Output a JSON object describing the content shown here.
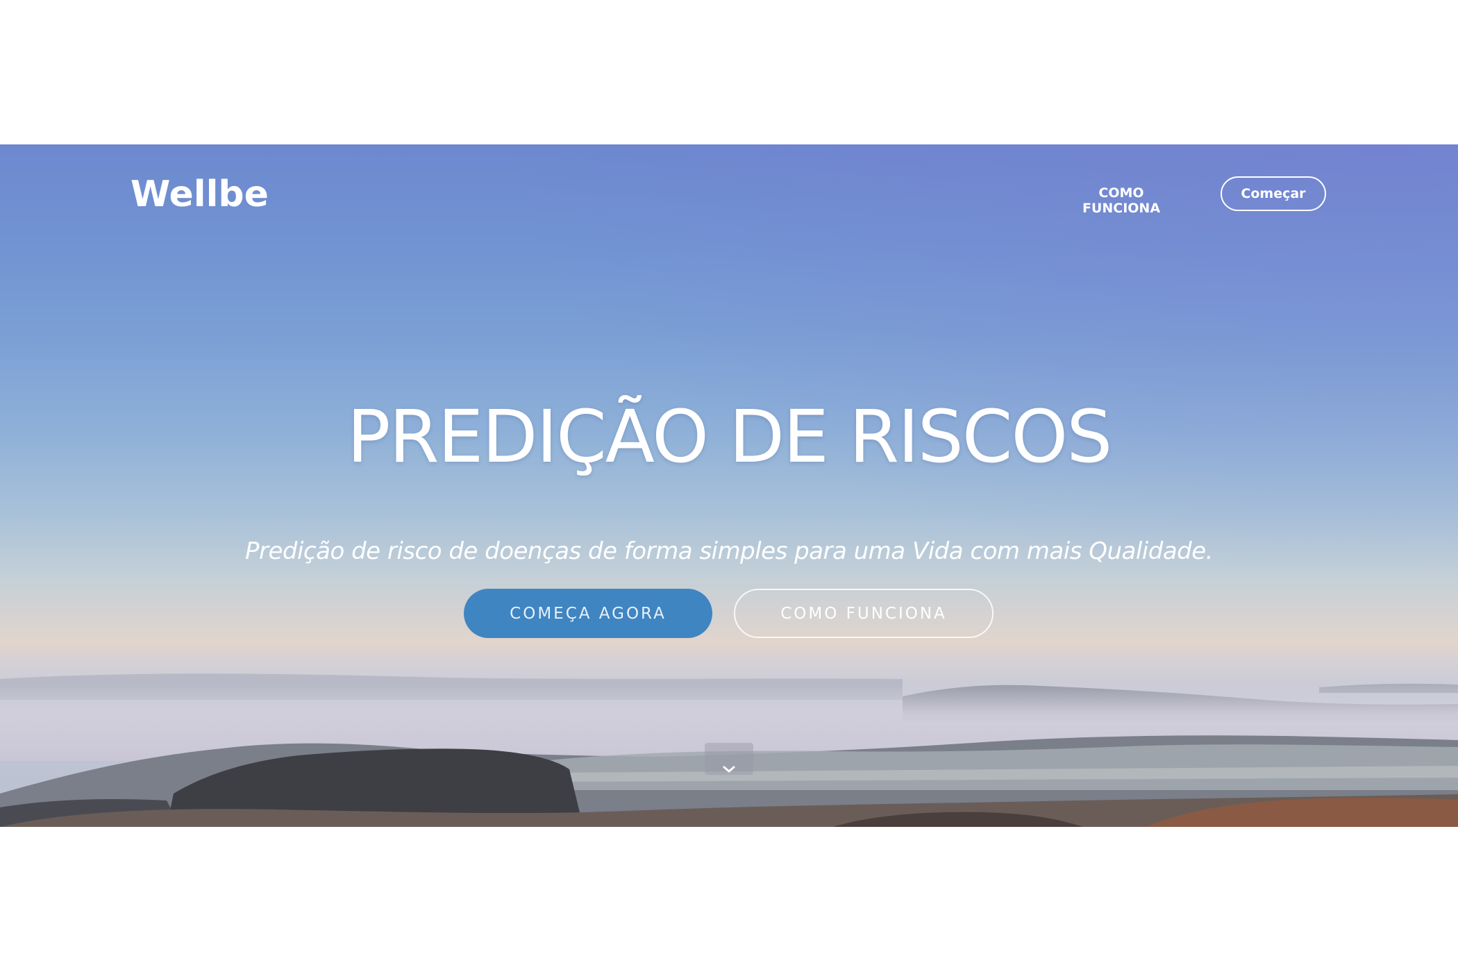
{
  "nav": {
    "logo": "Wellbe",
    "link_label": "COMO FUNCIONA",
    "button_label": "Começar"
  },
  "hero": {
    "title": "PREDIÇÃO DE RISCOS",
    "subtitle": "Predição de risco de doenças de forma simples para uma Vida com mais Qualidade.",
    "primary_cta": "COMEÇA AGORA",
    "secondary_cta": "COMO FUNCIONA"
  },
  "icons": {
    "scroll": "chevron-down-icon"
  },
  "colors": {
    "primary_button": "#3f85c2",
    "sky_top": "#6d88cf",
    "horizon": "#e2d4cc"
  }
}
